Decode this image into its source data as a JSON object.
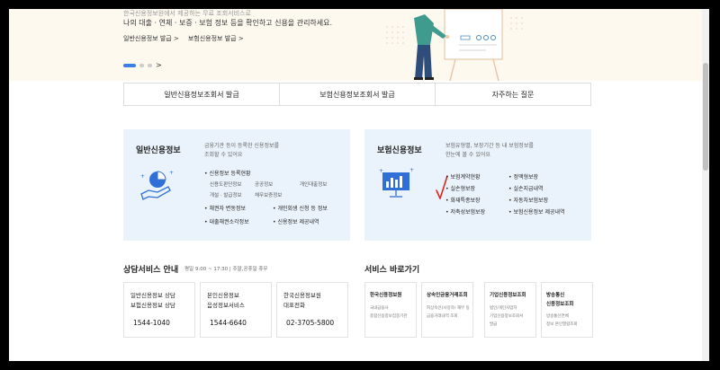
{
  "hero": {
    "faded_line": "한국신용정보원에서 제공하는 무료 조회서비스로",
    "text": "나의 대출 · 연체 · 보증 · 보험 정보 등을 확인하고 신용을 관리하세요.",
    "links": [
      "일반신용정보 발급 >",
      "보험신용정보 발급 >"
    ],
    "next_arrow": ">"
  },
  "tabs": [
    "일반신용정보조회서 발급",
    "보험신용정보조회서 발급",
    "자주하는 질문"
  ],
  "general_card": {
    "title": "일반신용정보",
    "desc_line1": "금융기관 등이 등록한 신용정보를",
    "desc_line2": "조회할 수 있어요",
    "items": {
      "registered": "신용정보 등록현황",
      "sub1": "신용도판단정보",
      "sub2": "공공정보",
      "sub3": "개인대출정보",
      "sub4": "개설 · 발급정보",
      "sub5": "채무보증정보",
      "creditor": "채권자 변동정보",
      "rehab": "개인회생 신청 등 정보",
      "loan_cause": "대출채권소각정보",
      "provide": "신용정보 제공내역"
    }
  },
  "insurance_card": {
    "title": "보험신용정보",
    "desc_line1": "보험유형별, 보장기간 등 내 보험정보를",
    "desc_line2": "한눈에 볼 수 있어요",
    "items": [
      "보험계약현황",
      "정액형보장",
      "실손형보장",
      "실손지급내역",
      "화재특종보장",
      "자동차보험보장",
      "저축성보험보장",
      "보험신용정보 제공내역"
    ]
  },
  "consult": {
    "title": "상담서비스 안내",
    "hours": "평일 9:00 ~ 17:30 | 주말,공휴일 휴무",
    "boxes": [
      {
        "line1": "일반신용정보 상담",
        "line2": "보험신용정보 상담",
        "phone": "1544-1040"
      },
      {
        "line1": "본인신용정보",
        "line2": "음성정보서비스",
        "phone": "1544-6640"
      },
      {
        "line1": "한국신용정보원",
        "line2": "대표전화",
        "phone": "02-3705-5800"
      }
    ]
  },
  "shortcuts": {
    "title": "서비스 바로가기",
    "boxes": [
      {
        "line1": "한국신용정보원",
        "line2": "",
        "sub1": "국내금융사",
        "sub2": "종합신용정보집중기관"
      },
      {
        "line1": "상속인금융거래조회",
        "line2": "",
        "sub1": "피상속인(사망자) 재무 등",
        "sub2": "금융거래내역 조회"
      },
      {
        "line1": "기업신용정보조회",
        "line2": "",
        "sub1": "법인/개인사업자",
        "sub2": "기업신용정보조회서",
        "sub3": "발급"
      },
      {
        "line1": "방송통신",
        "line2": "신용정보조회",
        "sub1": "방송통신연체",
        "sub2": "정보 본인열람조회"
      }
    ]
  },
  "colors": {
    "accent": "#3a7ee8",
    "card_bg": "#eaf3fc",
    "hero_bg": "#fdf9ef",
    "checkmark": "#d8281c"
  }
}
